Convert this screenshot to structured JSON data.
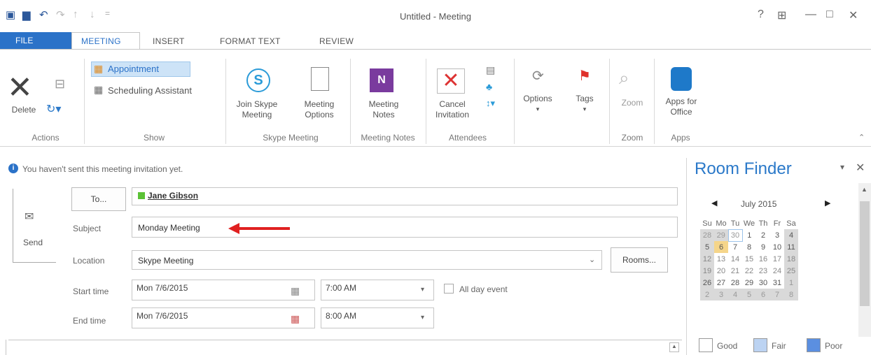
{
  "window": {
    "title": "Untitled - Meeting"
  },
  "quick_access": {
    "undo_icon": "undo-icon",
    "redo_icon": "redo-icon",
    "up_icon": "↑",
    "down_icon": "↓",
    "more": "="
  },
  "window_controls": {
    "help": "?",
    "restore_ribbon": "⊞",
    "minimize": "—",
    "maximize": "□",
    "close": "✕"
  },
  "tabs": {
    "file": "FILE",
    "meeting": "MEETING",
    "insert": "INSERT",
    "format_text": "FORMAT TEXT",
    "review": "REVIEW"
  },
  "ribbon": {
    "delete": "Delete",
    "appointment": "Appointment",
    "scheduling_assistant": "Scheduling Assistant",
    "join_skype_line1": "Join Skype",
    "join_skype_line2": "Meeting",
    "meeting_options_line1": "Meeting",
    "meeting_options_line2": "Options",
    "meeting_notes_line1": "Meeting",
    "meeting_notes_line2": "Notes",
    "cancel_invitation_line1": "Cancel",
    "cancel_invitation_line2": "Invitation",
    "options": "Options",
    "tags": "Tags",
    "zoom": "Zoom",
    "apps_line1": "Apps for",
    "apps_line2": "Office",
    "groups": {
      "actions": "Actions",
      "show": "Show",
      "skype_meeting": "Skype Meeting",
      "meeting_notes": "Meeting Notes",
      "attendees": "Attendees",
      "zoom": "Zoom",
      "apps": "Apps"
    }
  },
  "info_bar": "You haven't sent this meeting invitation yet.",
  "form": {
    "send": "Send",
    "to_button": "To...",
    "to_value": "Jane Gibson",
    "subject_label": "Subject",
    "subject_value": "Monday Meeting",
    "location_label": "Location",
    "location_value": "Skype Meeting",
    "rooms_button": "Rooms...",
    "start_label": "Start time",
    "start_date": "Mon 7/6/2015",
    "start_time": "7:00 AM",
    "all_day": "All day event",
    "end_label": "End time",
    "end_date": "Mon 7/6/2015",
    "end_time": "8:00 AM"
  },
  "room_finder": {
    "title": "Room Finder",
    "month": "July 2015",
    "weekdays": [
      "Su",
      "Mo",
      "Tu",
      "We",
      "Th",
      "Fr",
      "Sa"
    ],
    "weeks": [
      [
        "28",
        "29",
        "30",
        "1",
        "2",
        "3",
        "4"
      ],
      [
        "5",
        "6",
        "7",
        "8",
        "9",
        "10",
        "11"
      ],
      [
        "12",
        "13",
        "14",
        "15",
        "16",
        "17",
        "18"
      ],
      [
        "19",
        "20",
        "21",
        "22",
        "23",
        "24",
        "25"
      ],
      [
        "26",
        "27",
        "28",
        "29",
        "30",
        "31",
        "1"
      ],
      [
        "2",
        "3",
        "4",
        "5",
        "6",
        "7",
        "8"
      ]
    ],
    "legend": {
      "good": "Good",
      "fair": "Fair",
      "poor": "Poor"
    }
  },
  "colors": {
    "accent": "#2b72c8",
    "room_finder_title": "#2b79c9",
    "selected_day": "#f5d58a",
    "weekend_shade": "#d9d9d9",
    "arrow": "#e02020"
  }
}
